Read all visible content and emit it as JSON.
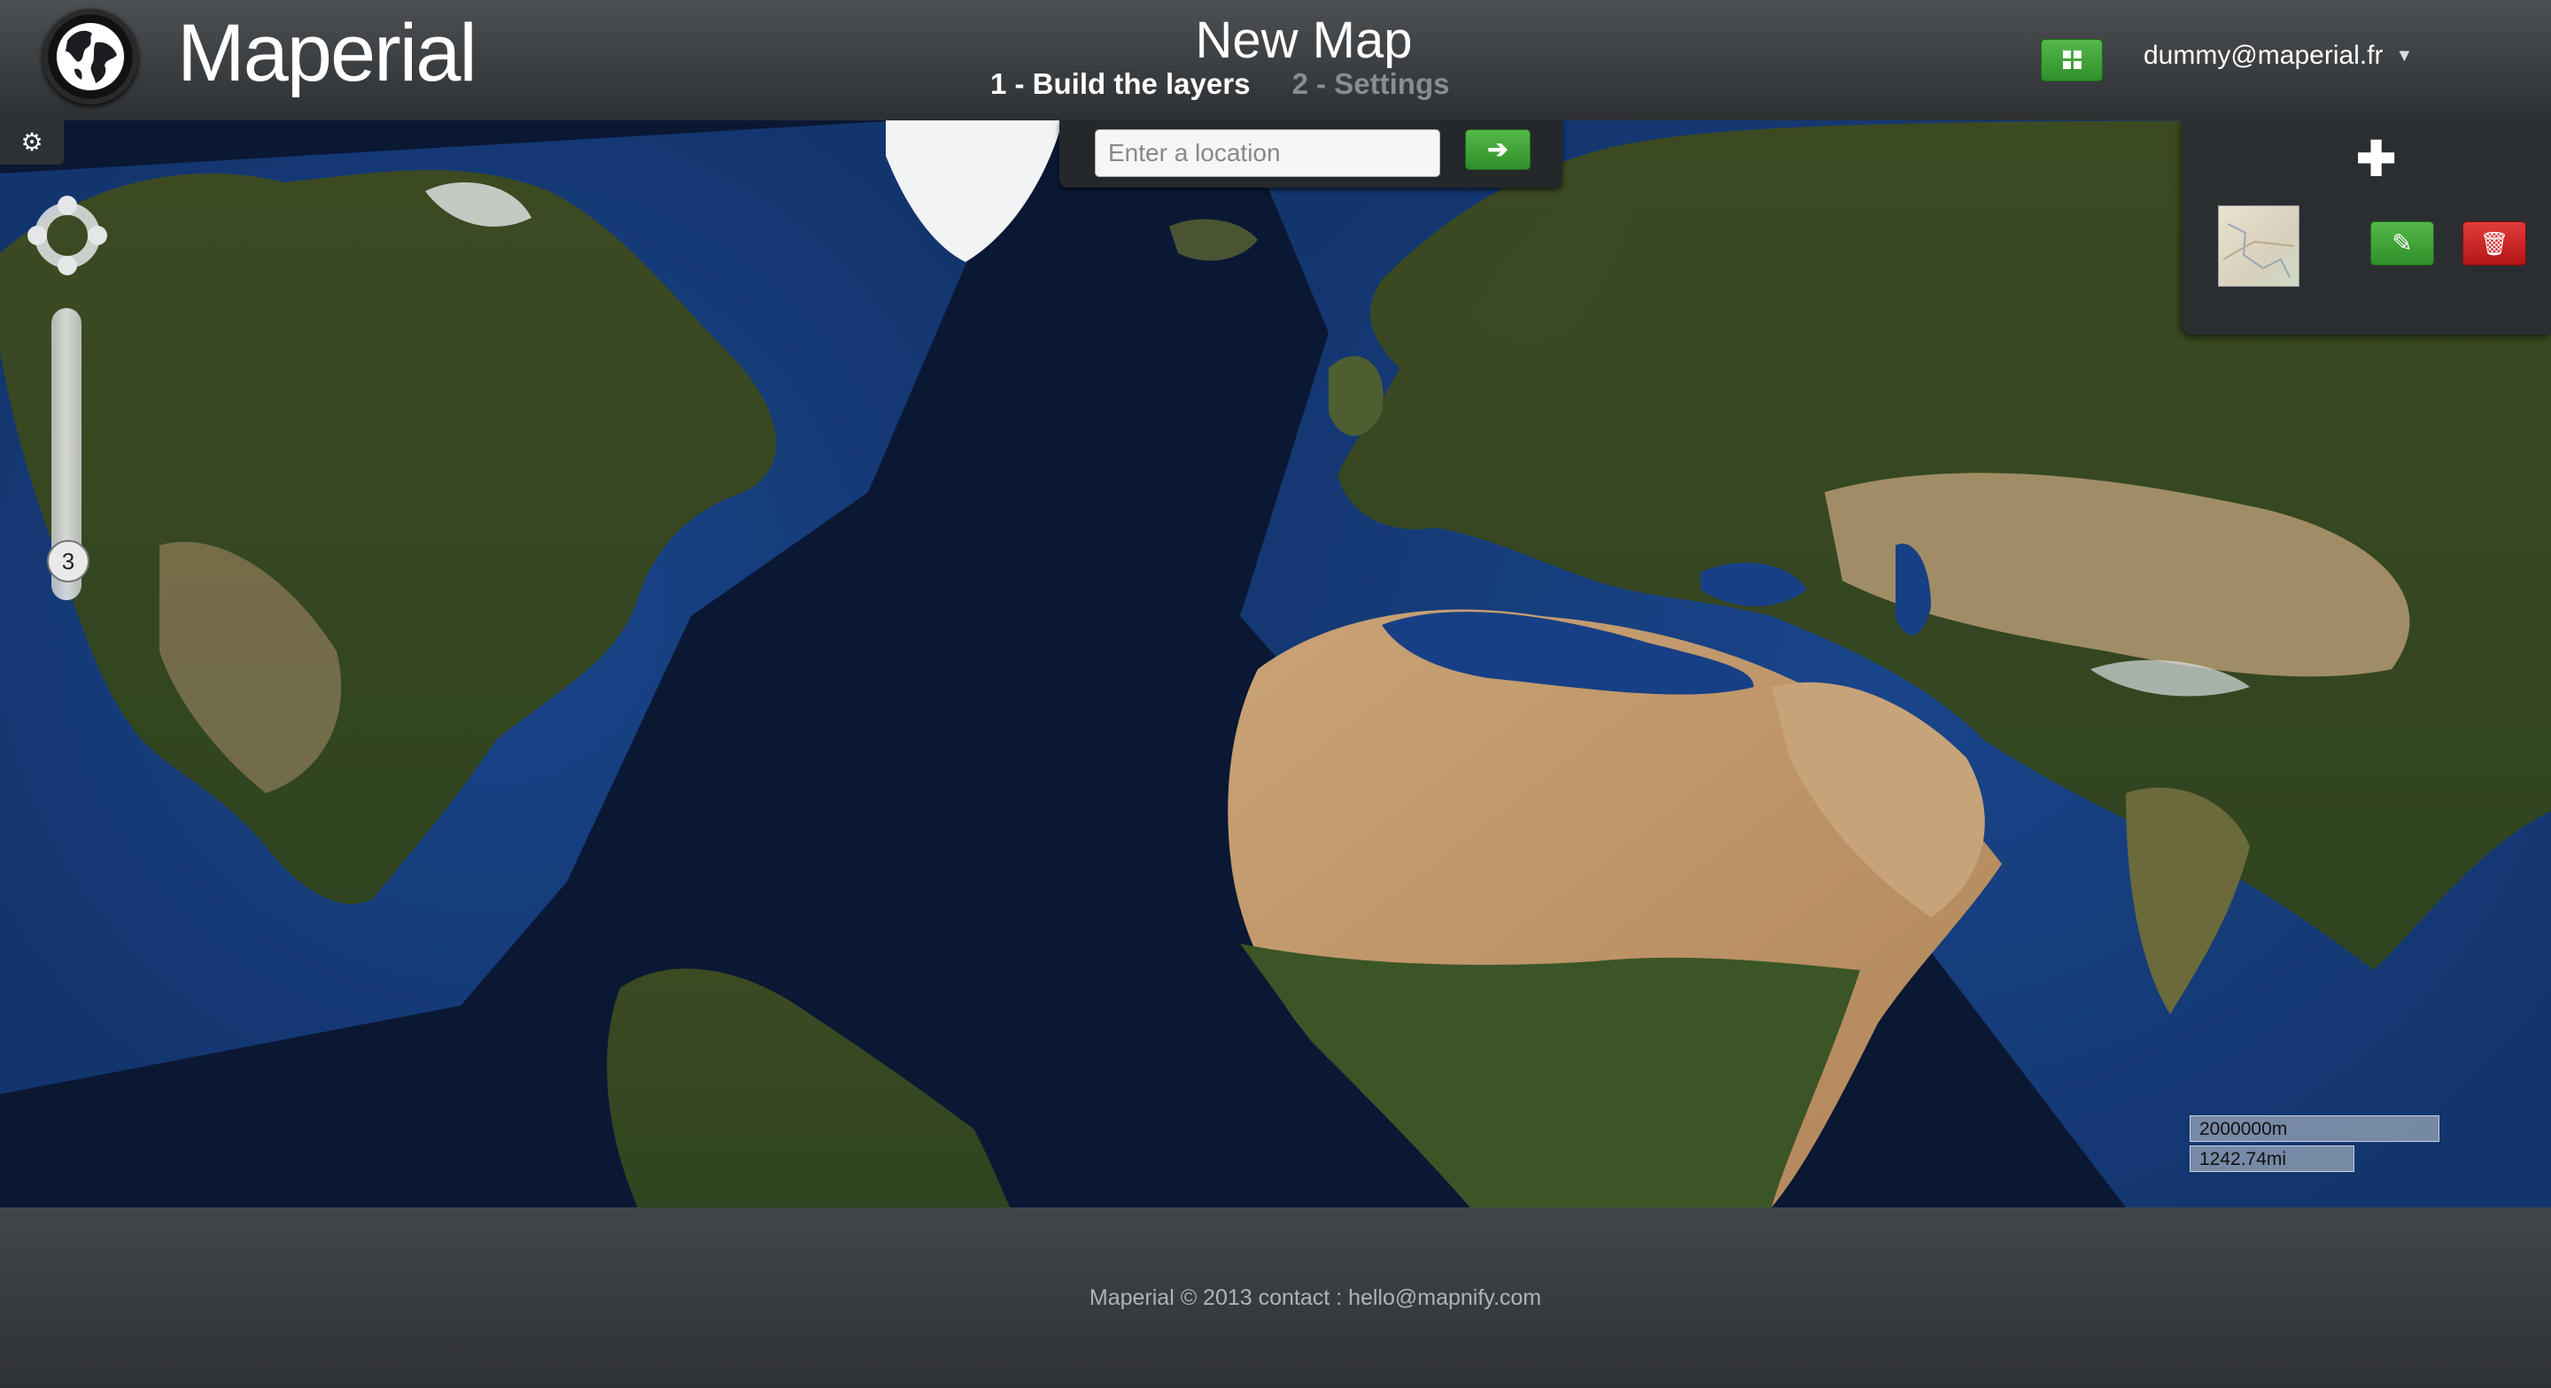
{
  "header": {
    "brand": "Maperial",
    "logo_icon": "globe-icon",
    "map_title": "New Map",
    "steps": [
      {
        "label": "1 - Build the layers",
        "active": true
      },
      {
        "label": "2 - Settings",
        "active": false
      }
    ],
    "apps_button_icon": "grid-icon",
    "user_email": "dummy@maperial.fr",
    "user_caret": "▼"
  },
  "map": {
    "settings_icon": "gear-icon",
    "settings_glyph": "⚙",
    "zoom_level": "3",
    "search": {
      "placeholder": "Enter a location",
      "value": "",
      "go_glyph": "➔"
    },
    "layers": {
      "add_glyph": "✚",
      "edit_glyph": "✎",
      "delete_glyph": "🗑"
    },
    "scale": {
      "metric": "2000000m",
      "imperial": "1242.74mi"
    }
  },
  "footer": {
    "text": "Maperial © 2013 contact : hello@mapnify.com"
  },
  "colors": {
    "accent_green": "#3ea335",
    "danger_red": "#c82020",
    "header_bg": "#3a3d40",
    "ocean": "#0c1a38"
  }
}
